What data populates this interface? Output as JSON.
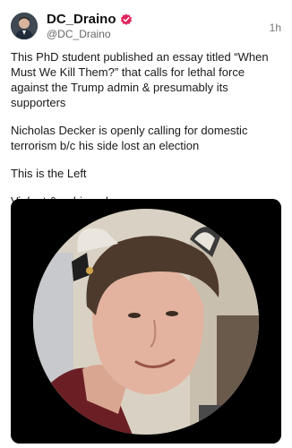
{
  "post": {
    "author": {
      "display_name": "DC_Draino",
      "handle": "@DC_Draino",
      "verified": true,
      "verified_color": "#e0245e"
    },
    "timestamp": "1h",
    "paragraphs": [
      "This PhD student published an essay titled “When Must We Kill Them?” that calls for lethal force against the Trump admin & presumably its supporters",
      "Nicholas Decker is openly calling for domestic terrorism b/c his side lost an election",
      "This is the Left",
      "Violent & unhinged"
    ],
    "media": {
      "icon": "profile-photo-image"
    }
  }
}
